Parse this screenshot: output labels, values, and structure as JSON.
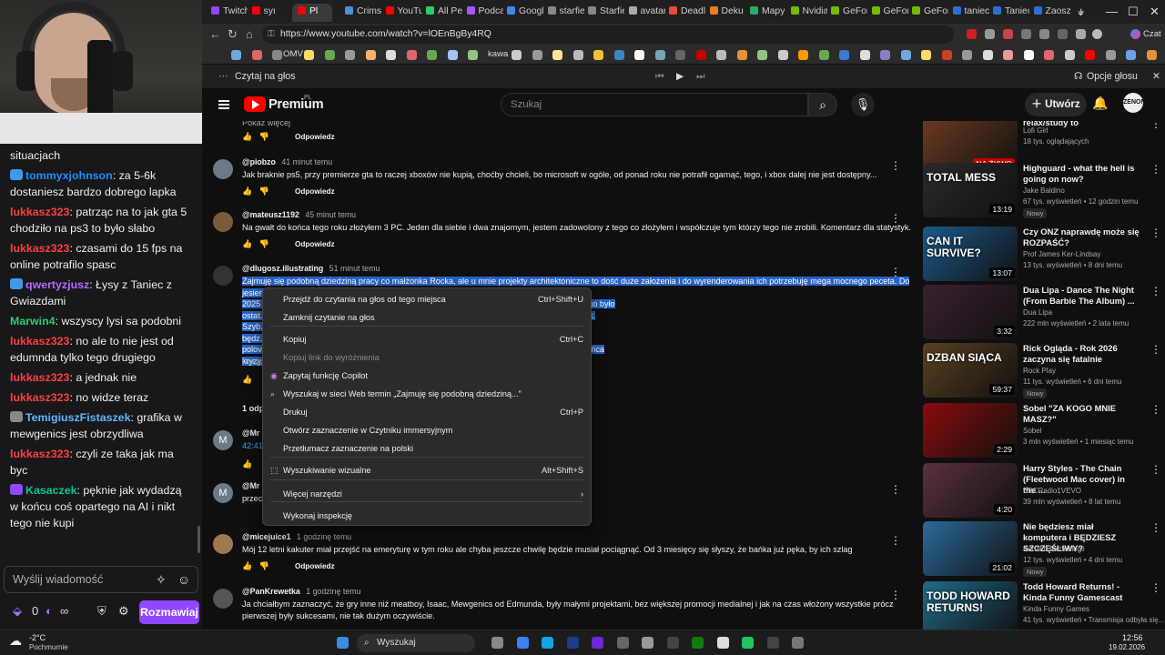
{
  "chat": {
    "messages": [
      {
        "user": "",
        "text": "situacjach",
        "color": "#efeff1",
        "badge": ""
      },
      {
        "user": "tommyxjohnson",
        "text": "za 5-6k dostaniesz bardzo dobrego lapka",
        "color": "#1e90ff",
        "badge": "#3d9be9"
      },
      {
        "user": "lukkasz323",
        "text": "patrząc na to jak gta 5 chodziło na ps3 to było słabo",
        "color": "#ff4040",
        "badge": ""
      },
      {
        "user": "lukkasz323",
        "text": "czasami do 15 fps na online potrafilo spasc",
        "color": "#ff4040",
        "badge": ""
      },
      {
        "user": "qwertyzjusz",
        "text": "Łysy z Taniec z Gwiazdami",
        "color": "#b66bff",
        "badge": "#3d9be9"
      },
      {
        "user": "Marwin4",
        "text": "wszyscy lysi sa podobni",
        "color": "#2ecc71",
        "badge": ""
      },
      {
        "user": "lukkasz323",
        "text": "no ale to nie jest od edumnda tylko tego drugiego",
        "color": "#ff4040",
        "badge": ""
      },
      {
        "user": "lukkasz323",
        "text": "a jednak nie",
        "color": "#ff4040",
        "badge": ""
      },
      {
        "user": "lukkasz323",
        "text": "no widze teraz",
        "color": "#ff4040",
        "badge": ""
      },
      {
        "user": "TemigiuszFistaszek",
        "text": "grafika w mewgenics jest obrzydliwa",
        "color": "#5fb6ff",
        "badge": "#888"
      },
      {
        "user": "lukkasz323",
        "text": "czyli ze taka jak ma byc",
        "color": "#ff4040",
        "badge": ""
      },
      {
        "user": "Kasaczek",
        "text": "pęknie jak wydadzą w końcu coś opartego na AI i nikt tego nie kupi",
        "color": "#00c98d",
        "badge": "#9147ff"
      }
    ],
    "input_placeholder": "Wyślij wiadomość",
    "points": "0",
    "chat_button": "Rozmawiaj"
  },
  "browser": {
    "tabs": [
      "Twitch",
      "syı",
      "Pl",
      "Crimso",
      "YouTu",
      "All Pen",
      "Podcas",
      "Googl",
      "starfie",
      "Starfie",
      "avatar",
      "Deadl",
      "Deku L",
      "Mapy",
      "Nvidia",
      "GeFor",
      "GeFor",
      "GeFor",
      "taniec",
      "Taniec",
      "Zaoszc"
    ],
    "url": "https://www.youtube.com/watch?v=lOEnBgBy4RQ",
    "bookmarks": [
      "OMV",
      "kawa"
    ],
    "read_aloud": "Czytaj na głos",
    "read_aloud_options": "Opcje głosu",
    "profile_label": "Czat"
  },
  "youtube": {
    "brand": "Premium",
    "brand_sup": "PL",
    "search_placeholder": "Szukaj",
    "create_label": "Utwórz",
    "avatar_text": "ZENON",
    "show_more_top": "Pokaż więcej",
    "reply": "Odpowiedz",
    "comments": [
      {
        "author": "@piobzo",
        "time": "41 minut temu",
        "text": "Jak braknie ps5, przy premierze gta to raczej xboxów nie kupią, choćby chcieli, bo microsoft w ogóle, od ponad roku nie potrafił ogarnąć, tego, i xbox dalej nie jest dostępny...",
        "initial": "",
        "avatar_color": "#5d6d7a"
      },
      {
        "author": "@mateusz1192",
        "time": "45 minut temu",
        "text": "Na gwałt do końca tego roku złożyłem 3 PC. Jeden dla siebie i dwa znajomym, jestem zadowolony z tego co złożyłem i współczuje tym którzy tego nie zrobili. Komentarz dla statystyk.",
        "initial": "",
        "avatar_color": "#7b5a3c"
      },
      {
        "author": "@dlugosz.illustrating",
        "time": "51 minut temu",
        "text_lines": [
          "Zajmuję się podobną dziedziną pracy co małżonka Rocka, ale u mnie projekty architektoniczne to dość duże założenia i do wyrenderowania ich potrzebuję mega mocnego peceta. Do jesieni",
          "2025 ... teriał Liptona na Twoim strimie, Borys, to szybko poleciałem na zabezpieczyć RAM. Tego było",
          "ostat... a/trzy tygodnie później, nie były już dostępne i wróciły pod koniec roku z ceną już 10-12k.",
          "Szyb... udało mi się dostać bez problemów. Oczywiście prócz 5090, ale tą, to wiedziałem, że",
          "będz... w normalnej cenie. W tamtym roku planowałem wymianę całej stacji roboczej na",
          "polov... upą w tym nocniku) przez jeszcze wiele lat. Wznoście modły, aby mi nic nie padło do końca",
          "kryzy..."
        ],
        "initial": "",
        "avatar_color": "#444"
      },
      {
        "author": "@Mr",
        "time": "",
        "text": "42:41",
        "initial": "M",
        "avatar_color": "#5a6670"
      },
      {
        "author": "@Mr",
        "time": "",
        "text": "przec... arzekają na finał GoT",
        "initial": "M",
        "avatar_color": "#5a6670"
      },
      {
        "author": "@micejuice1",
        "time": "1 godzinę temu",
        "text": "Mój 12 letni kakuter miał przejść na emeryturę w tym roku ale chyba jeszcze chwilę będzie musiał pociągnąć. Od 3 miesięcy się słyszy, że bańka już pęka, by ich szlag",
        "initial": "",
        "avatar_color": "#a07850"
      },
      {
        "author": "@PanKrewetka",
        "time": "1 godzinę temu",
        "text": "Ja chciałbym zaznaczyć, że gry inne niż meatboy, Isaac, Mewgenics od Edmunda, były małymi projektami, bez większej promocji medialnej i jak na czas włożony wszystkie prócz pierwszej były sukcesami, nie tak dużym oczywiście.",
        "initial": "",
        "avatar_color": "#555"
      }
    ],
    "show_more": "Pokaż",
    "replies_count": "1 odp"
  },
  "context_menu": {
    "items": [
      {
        "label": "Przejdź do czytania na głos od tego miejsca",
        "shortcut": "Ctrl+Shift+U",
        "disabled": false
      },
      {
        "label": "Zamknij czytanie na głos",
        "shortcut": "",
        "disabled": false
      },
      {
        "label": "Kopiuj",
        "shortcut": "Ctrl+C",
        "disabled": false
      },
      {
        "label": "Kopiuj link do wyróżnienia",
        "shortcut": "",
        "disabled": true
      },
      {
        "label": "Zapytaj funkcję Copilot",
        "shortcut": "",
        "disabled": false
      },
      {
        "label": "Wyszukaj w sieci Web termin „Zajmuję się podobną dziedziną...”",
        "shortcut": "",
        "disabled": false
      },
      {
        "label": "Drukuj",
        "shortcut": "Ctrl+P",
        "disabled": false
      },
      {
        "label": "Otwórz zaznaczenie w Czytniku immersyjnym",
        "shortcut": "",
        "disabled": false
      },
      {
        "label": "Przetłumacz zaznaczenie na polski",
        "shortcut": "",
        "disabled": false
      },
      {
        "label": "Wyszukiwanie wizualne",
        "shortcut": "Alt+Shift+S",
        "disabled": false
      },
      {
        "label": "Więcej narzędzi",
        "shortcut": "›",
        "disabled": false
      },
      {
        "label": "Wykonaj inspekcję",
        "shortcut": "",
        "disabled": false
      }
    ]
  },
  "sidebar": {
    "videos": [
      {
        "title": "relax/study to",
        "channel": "Lofi Girl",
        "meta": "18 tys. oglądających",
        "duration": "NA ŻYWO",
        "overlay": "",
        "badge": "",
        "color": "#6b3b1f"
      },
      {
        "title": "Highguard - what the hell is going on now?",
        "channel": "Jake Baldino",
        "meta": "67 tys. wyświetleń • 12 godzin temu",
        "duration": "13:19",
        "overlay": "TOTAL MESS",
        "badge": "Nowy",
        "color": "#2a2a2a"
      },
      {
        "title": "Czy ONZ naprawdę może się ROZPAŚĆ?",
        "channel": "Prof James Ker-Lindsay",
        "meta": "13 tys. wyświetleń • 8 dni temu",
        "duration": "13:07",
        "overlay": "CAN IT SURVIVE?",
        "badge": "",
        "color": "#1b5a8a"
      },
      {
        "title": "Dua Lipa - Dance The Night (From Barbie The Album) ...",
        "channel": "Dua Lipa",
        "meta": "222 mln wyświetleń • 2 lata temu",
        "duration": "3:32",
        "overlay": "",
        "badge": "",
        "color": "#3a2030"
      },
      {
        "title": "Rick Ogląda - Rok 2026 zaczyna się fatalnie",
        "channel": "Rock Play",
        "meta": "11 tys. wyświetleń • 6 dni temu",
        "duration": "59:37",
        "overlay": "DZBAN SIĄCA",
        "badge": "Nowy",
        "color": "#5a4020"
      },
      {
        "title": "Sobel \"ZA KOGO MNIE MASZ?\"",
        "channel": "Sobel",
        "meta": "3 mln wyświetleń • 1 miesiąc temu",
        "duration": "2:29",
        "overlay": "",
        "badge": "",
        "color": "#8a0b0b"
      },
      {
        "title": "Harry Styles - The Chain (Fleetwood Mac cover) in the ...",
        "channel": "BBCRadio1VEVO",
        "meta": "39 mln wyświetleń • 8 lat temu",
        "duration": "4:20",
        "overlay": "",
        "badge": "",
        "color": "#5a3040"
      },
      {
        "title": "Nie będziesz miał komputera i BĘDZIESZ SZCZĘŚLIWY?",
        "channel": "Kanał o technologii",
        "meta": "12 tys. wyświetleń • 4 dni temu",
        "duration": "21:02",
        "overlay": "",
        "badge": "Nowy",
        "color": "#2a6a9a"
      },
      {
        "title": "Todd Howard Returns! - Kinda Funny Gamescast",
        "channel": "Kinda Funny Games",
        "meta": "41 tys. wyświetleń • Transmisja odbyła się...",
        "duration": "",
        "overlay": "TODD HOWARD RETURNS!",
        "badge": "",
        "color": "#1f6b8a"
      }
    ]
  },
  "taskbar": {
    "weather_temp": "-2°C",
    "weather_desc": "Pochmurnie",
    "search": "Wyszukaj",
    "time": "12:56",
    "date": "19.02.2026"
  }
}
